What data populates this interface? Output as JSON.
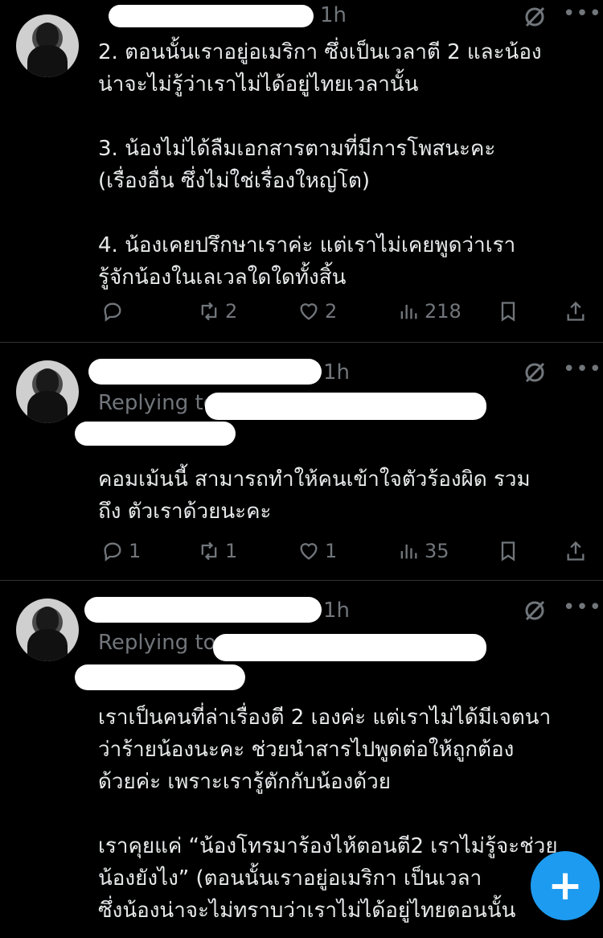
{
  "tweets": [
    {
      "time": "1h",
      "replying_prefix": "",
      "text": "2. ตอนนั้นเราอยู่อเมริกา ซึ่งเป็นเวลาตี 2 และน้อง\nน่าจะไม่รู้ว่าเราไม่ได้อยู่ไทยเวลานั้น\n\n3. น้องไม่ได้ลืมเอกสารตามที่มีการโพสนะคะ\n(เรื่องอื่น ซึ่งไม่ใช่เรื่องใหญ่โต)\n\n4. น้องเคยปรึกษาเราค่ะ แต่เราไม่เคยพูดว่าเรา\nรู้จักน้องในเลเวลใดใดทั้งสิ้น",
      "replies": "",
      "reposts": "2",
      "likes": "2",
      "views": "218"
    },
    {
      "time": "1h",
      "replying_prefix": "Replying to",
      "text": "คอมเม้นนี้ สามารถทำให้คนเข้าใจตัวร้องผิด รวม\nถึง ตัวเราด้วยนะคะ",
      "replies": "1",
      "reposts": "1",
      "likes": "1",
      "views": "35"
    },
    {
      "time": "1h",
      "replying_prefix": "Replying to",
      "text": "เราเป็นคนที่ล่าเรื่องตี 2 เองค่ะ แต่เราไม่ได้มีเจตนา\nว่าร้ายน้องนะคะ ช่วยนำสารไปพูดต่อให้ถูกต้อง\nด้วยค่ะ เพราะเรารู้ตักกับน้องด้วย\n\nเราคุยแค่ “น้องโทรมาร้องไห้ตอนตี2 เราไม่รู้จะช่วย\nน้องยังไง” (ตอนนั้นเราอยู่อเมริกา เป็นเวลา\nซึ่งน้องน่าจะไม่ทราบว่าเราไม่ได้อยู่ไทยตอนนั้น"
    }
  ],
  "colors": {
    "accent": "#1d9bf0",
    "muted": "#71767b",
    "text": "#e7e9ea",
    "divider": "#2f3336"
  },
  "fab": {
    "label": "+"
  }
}
